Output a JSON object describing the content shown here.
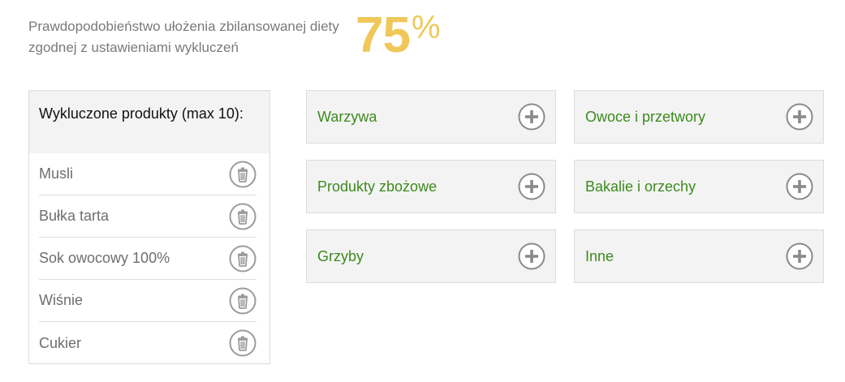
{
  "probability": {
    "text": "Prawdopodobieństwo ułożenia zbilansowanej diety zgodnej z ustawieniami wykluczeń",
    "value": "75",
    "unit": "%"
  },
  "excluded": {
    "header": "Wykluczone produkty (max 10):",
    "items": [
      {
        "label": "Musli"
      },
      {
        "label": "Bułka tarta"
      },
      {
        "label": "Sok owocowy 100%"
      },
      {
        "label": "Wiśnie"
      },
      {
        "label": "Cukier"
      }
    ],
    "remove_icon": "trash-icon"
  },
  "categories": [
    {
      "label": "Warzywa"
    },
    {
      "label": "Owoce i przetwory"
    },
    {
      "label": "Produkty zbożowe"
    },
    {
      "label": "Bakalie i orzechy"
    },
    {
      "label": "Grzyby"
    },
    {
      "label": "Inne"
    }
  ],
  "add_icon": "plus-circle-icon",
  "colors": {
    "accent": "#f0c85a",
    "category_text": "#3d8a1f",
    "muted_text": "#7a7a7a",
    "panel_bg": "#f3f3f3"
  }
}
